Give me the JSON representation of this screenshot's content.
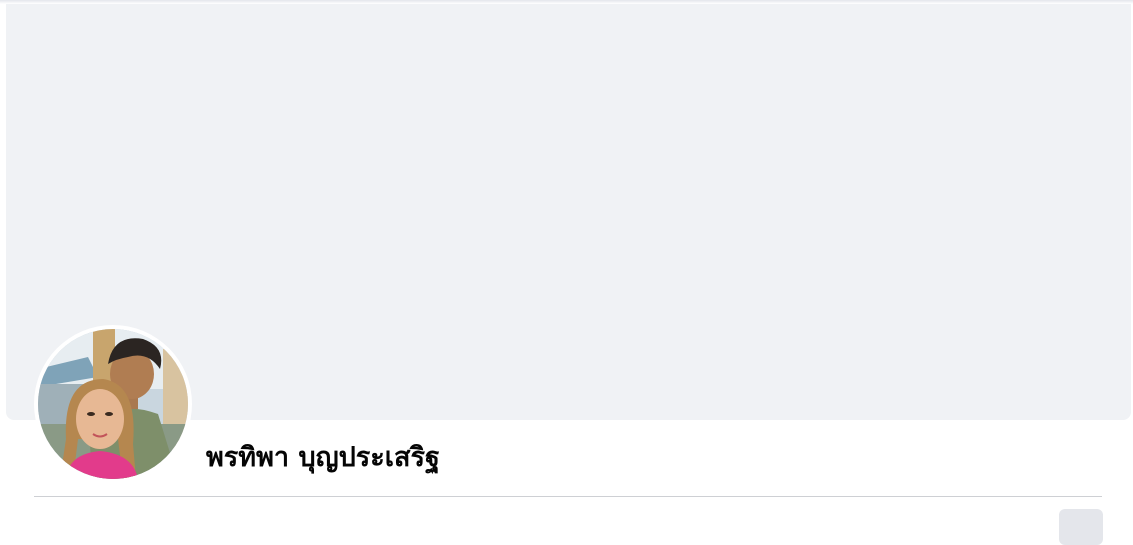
{
  "profile": {
    "name": "พรทิพา บุญประเสริฐ",
    "avatar_alt": "profile photo"
  },
  "colors": {
    "cover_background": "#f0f2f5",
    "divider": "#ced0d4",
    "name_text": "#050505"
  }
}
